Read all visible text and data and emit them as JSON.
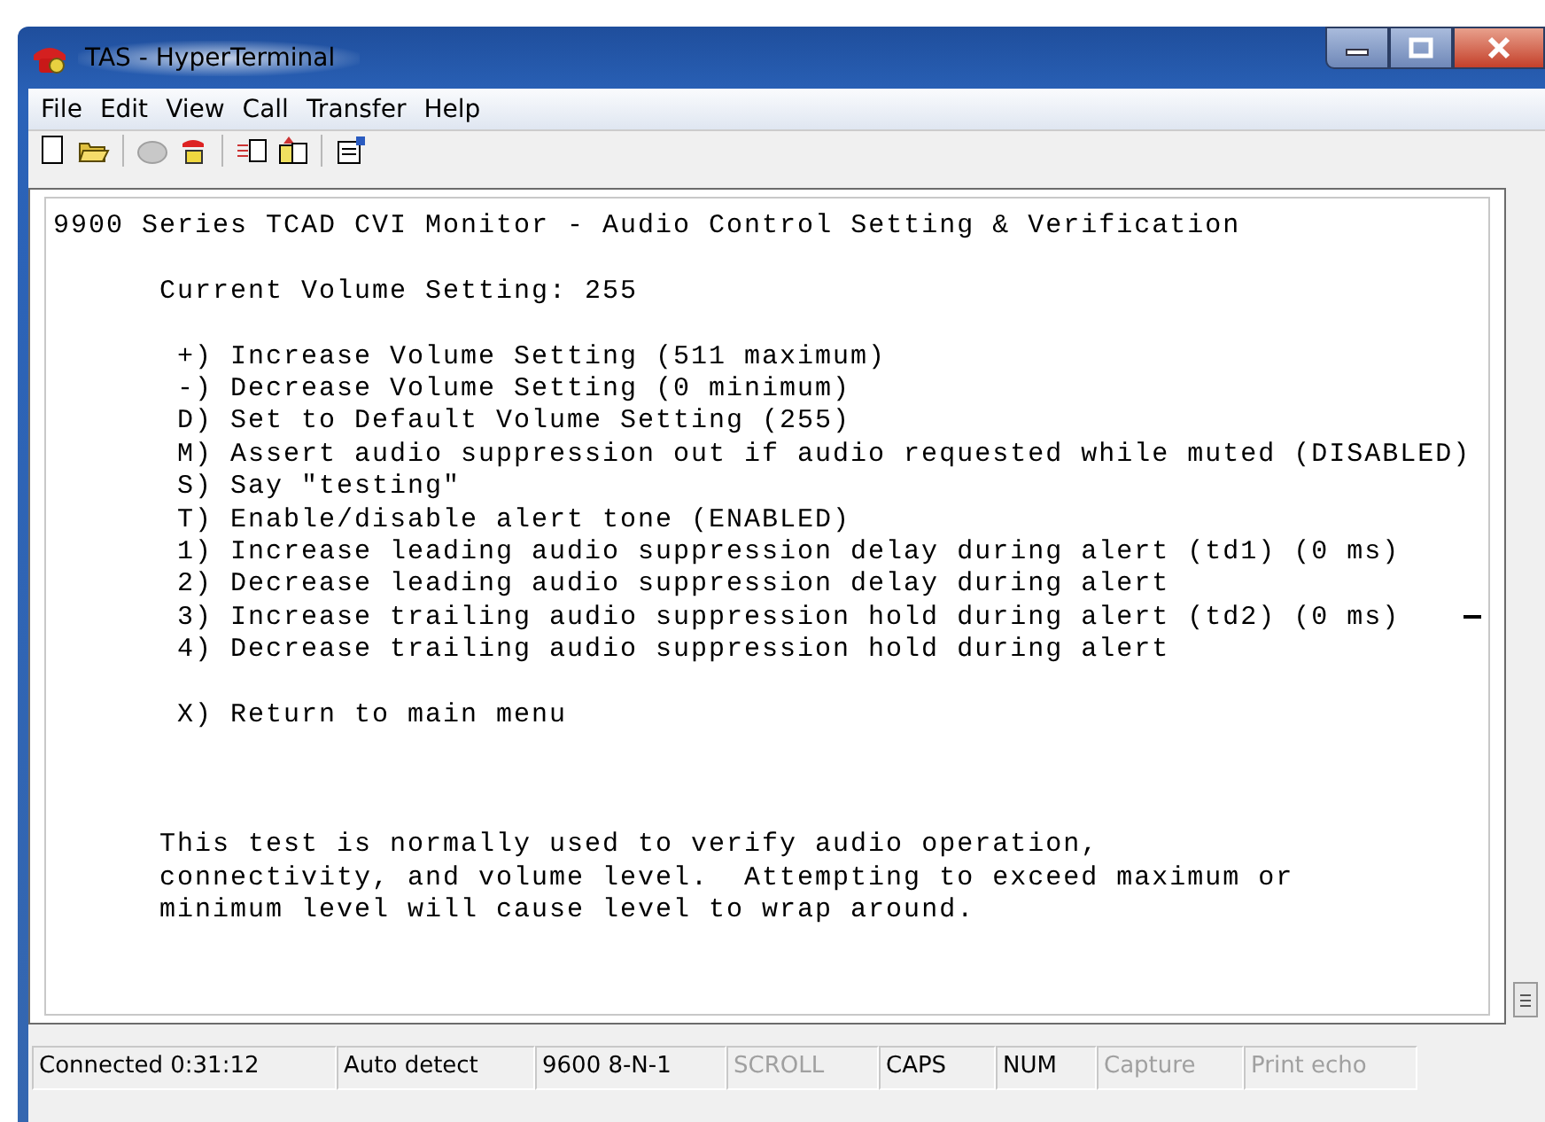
{
  "window": {
    "title": "TAS - HyperTerminal"
  },
  "menu": [
    "File",
    "Edit",
    "View",
    "Call",
    "Transfer",
    "Help"
  ],
  "terminal": {
    "sections": [
      {
        "kind": "heading",
        "lines": [
          "9900 Series TCAD CVI Monitor - Audio Control Setting & Verification"
        ]
      },
      {
        "kind": "setting",
        "lines": [
          "Current Volume Setting: 255"
        ]
      },
      {
        "kind": "options",
        "lines": [
          "+) Increase Volume Setting (511 maximum)",
          "-) Decrease Volume Setting (0 minimum)",
          "D) Set to Default Volume Setting (255)",
          "M) Assert audio suppression out if audio requested while muted (DISABLED)",
          "S) Say \"testing\"",
          "T) Enable/disable alert tone (ENABLED)",
          "1) Increase leading audio suppression delay during alert (td1) (0 ms)",
          "2) Decrease leading audio suppression delay during alert",
          "3) Increase trailing audio suppression hold during alert (td2) (0 ms)",
          "4) Decrease trailing audio suppression hold during alert"
        ]
      },
      {
        "kind": "options",
        "lines": [
          "X) Return to main menu"
        ]
      },
      {
        "kind": "note",
        "lines": [
          "This test is normally used to verify audio operation,",
          "connectivity, and volume level.  Attempting to exceed maximum or",
          "minimum level will cause level to wrap around."
        ]
      }
    ]
  },
  "status_bar": [
    {
      "text": "Connected 0:31:12",
      "disabled": false
    },
    {
      "text": "Auto detect",
      "disabled": false
    },
    {
      "text": "9600 8-N-1",
      "disabled": false
    },
    {
      "text": "SCROLL",
      "disabled": true
    },
    {
      "text": "CAPS",
      "disabled": false
    },
    {
      "text": "NUM",
      "disabled": false
    },
    {
      "text": "Capture",
      "disabled": true
    },
    {
      "text": "Print echo",
      "disabled": true
    }
  ]
}
